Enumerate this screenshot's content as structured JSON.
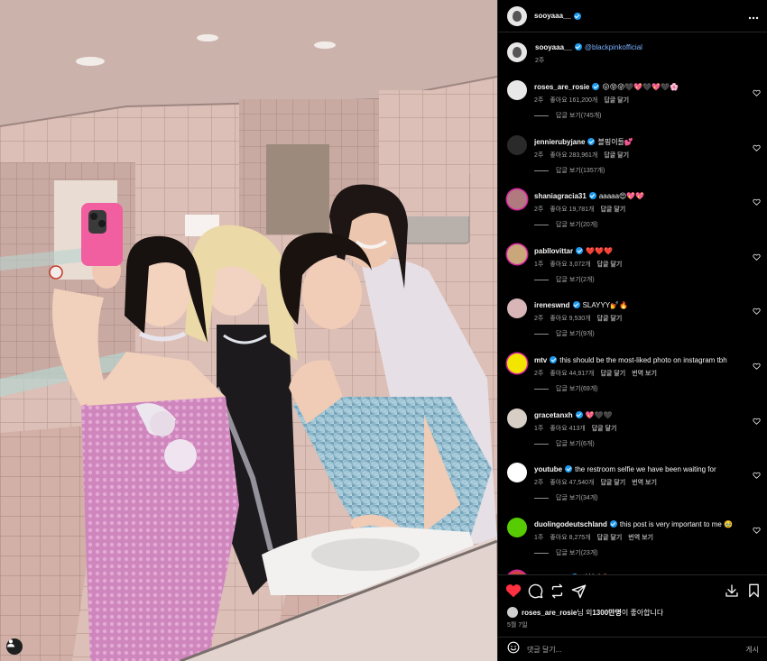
{
  "header": {
    "username": "sooyaaa__",
    "more_icon": "more-icon"
  },
  "caption": {
    "username": "sooyaaa__",
    "mention": "@blackpinkofficial",
    "time": "2주"
  },
  "comments": [
    {
      "username": "roses_are_rosie",
      "text": "😛😝😜🖤💖🖤💖🖤🌸",
      "time": "2주",
      "likes": "좋아요 161,200개",
      "reply": "답글 달기",
      "translate": "",
      "replies": "답글 보기(745개)",
      "avatar_color": "#e8e8e8",
      "story": false
    },
    {
      "username": "jennierubyjane",
      "text": "블핑이들💕",
      "time": "2주",
      "likes": "좋아요 283,961개",
      "reply": "답글 달기",
      "translate": "",
      "replies": "답글 보기(1357개)",
      "avatar_color": "#2a2a2a",
      "story": false
    },
    {
      "username": "shaniagracia31",
      "text": "aaaaa😍💖💖",
      "time": "2주",
      "likes": "좋아요 19,781개",
      "reply": "답글 달기",
      "translate": "",
      "replies": "답글 보기(20개)",
      "avatar_color": "#b07a7f",
      "story": true
    },
    {
      "username": "pabllovittar",
      "text": "❤️❤️❤️",
      "time": "1주",
      "likes": "좋아요 3,072개",
      "reply": "답글 달기",
      "translate": "",
      "replies": "답글 보기(2개)",
      "avatar_color": "#c9a77a",
      "story": true
    },
    {
      "username": "ireneswnd",
      "text": "SLAYYY💅🔥",
      "time": "2주",
      "likes": "좋아요 9,530개",
      "reply": "답글 달기",
      "translate": "",
      "replies": "답글 보기(9개)",
      "avatar_color": "#d8b6b8",
      "story": false
    },
    {
      "username": "mtv",
      "text": "this should be the most-liked photo on instagram tbh",
      "time": "2주",
      "likes": "좋아요 44,917개",
      "reply": "답글 달기",
      "translate": "번역 보기",
      "replies": "답글 보기(69개)",
      "avatar_color": "#f2e600",
      "story": true
    },
    {
      "username": "gracetanxh",
      "text": "💖🖤🖤",
      "time": "1주",
      "likes": "좋아요 413개",
      "reply": "답글 달기",
      "translate": "",
      "replies": "답글 보기(6개)",
      "avatar_color": "#d7cfc6",
      "story": false
    },
    {
      "username": "youtube",
      "text": "the restroom selfie we have been waiting for",
      "time": "2주",
      "likes": "좋아요 47,540개",
      "reply": "답글 달기",
      "translate": "번역 보기",
      "replies": "답글 보기(34개)",
      "avatar_color": "#ffffff",
      "story": false
    },
    {
      "username": "duolingodeutschland",
      "text": "this post is very important to me 🥹",
      "time": "1주",
      "likes": "좋아요 8,275개",
      "reply": "답글 달기",
      "translate": "번역 보기",
      "replies": "답글 보기(23개)",
      "avatar_color": "#58cc02",
      "story": false
    },
    {
      "username": "i.anagram",
      "text": "미쳤다🔥",
      "time": "",
      "likes": "",
      "reply": "",
      "translate": "",
      "replies": "",
      "avatar_color": "#c44",
      "story": true
    }
  ],
  "actions": {
    "liked_by_user": "roses_are_rosie",
    "liked_by_suffix": "님 외 ",
    "liked_count": "1300만명",
    "liked_end": "이 좋아합니다",
    "date": "5월 7일",
    "comment_placeholder": "댓글 달기...",
    "post_label": "게시"
  },
  "colors": {
    "like_red": "#ff3040",
    "verified": "#1d9bf0",
    "mention": "#7cb1ff"
  }
}
